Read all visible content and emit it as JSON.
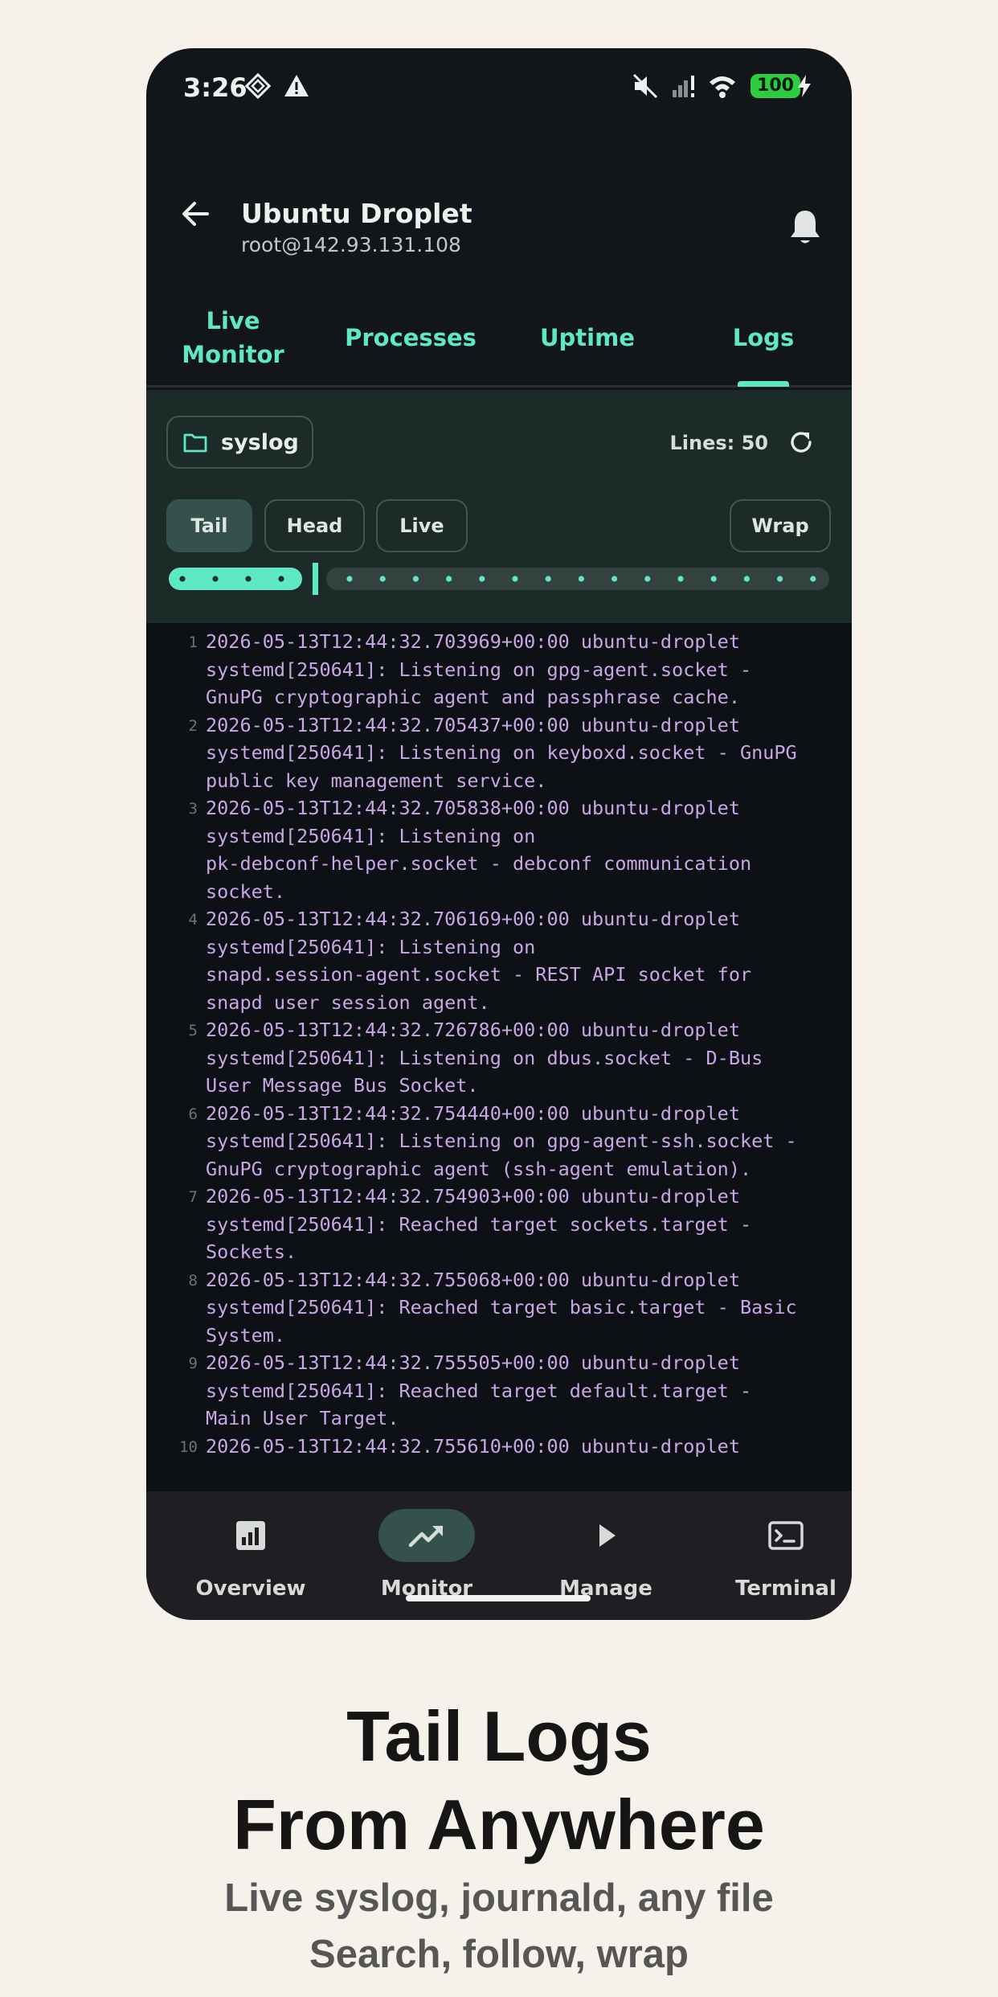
{
  "status_bar": {
    "time": "3:26",
    "battery": "100",
    "icons": [
      "vpn-key-icon",
      "alert-icon",
      "mute-icon",
      "signal-icon",
      "wifi-icon",
      "battery-charging-icon"
    ]
  },
  "app_bar": {
    "title": "Ubuntu Droplet",
    "subtitle": "root@142.93.131.108"
  },
  "tabs": [
    {
      "label": "Live\nMonitor"
    },
    {
      "label": "Processes"
    },
    {
      "label": "Uptime"
    },
    {
      "label": "Logs",
      "selected": true
    }
  ],
  "controls": {
    "file": "syslog",
    "lines_label": "Lines: 50",
    "modes": [
      {
        "label": "Tail",
        "selected": true
      },
      {
        "label": "Head"
      },
      {
        "label": "Live"
      }
    ],
    "wrap_label": "Wrap",
    "slider_value": 0.22
  },
  "log_lines": [
    {
      "n": "1",
      "text": "2026-05-13T12:44:32.703969+00:00 ubuntu-droplet\nsystemd[250641]: Listening on gpg-agent.socket -\nGnuPG cryptographic agent and passphrase cache."
    },
    {
      "n": "2",
      "text": "2026-05-13T12:44:32.705437+00:00 ubuntu-droplet\nsystemd[250641]: Listening on keyboxd.socket - GnuPG\npublic key management service."
    },
    {
      "n": "3",
      "text": "2026-05-13T12:44:32.705838+00:00 ubuntu-droplet\nsystemd[250641]: Listening on\npk-debconf-helper.socket - debconf communication\nsocket."
    },
    {
      "n": "4",
      "text": "2026-05-13T12:44:32.706169+00:00 ubuntu-droplet\nsystemd[250641]: Listening on\nsnapd.session-agent.socket - REST API socket for\nsnapd user session agent."
    },
    {
      "n": "5",
      "text": "2026-05-13T12:44:32.726786+00:00 ubuntu-droplet\nsystemd[250641]: Listening on dbus.socket - D-Bus\nUser Message Bus Socket."
    },
    {
      "n": "6",
      "text": "2026-05-13T12:44:32.754440+00:00 ubuntu-droplet\nsystemd[250641]: Listening on gpg-agent-ssh.socket -\nGnuPG cryptographic agent (ssh-agent emulation)."
    },
    {
      "n": "7",
      "text": "2026-05-13T12:44:32.754903+00:00 ubuntu-droplet\nsystemd[250641]: Reached target sockets.target -\nSockets."
    },
    {
      "n": "8",
      "text": "2026-05-13T12:44:32.755068+00:00 ubuntu-droplet\nsystemd[250641]: Reached target basic.target - Basic\nSystem."
    },
    {
      "n": "9",
      "text": "2026-05-13T12:44:32.755505+00:00 ubuntu-droplet\nsystemd[250641]: Reached target default.target -\nMain User Target."
    },
    {
      "n": "10",
      "text": "2026-05-13T12:44:32.755610+00:00 ubuntu-droplet"
    }
  ],
  "bottom_nav": [
    {
      "label": "Overview",
      "icon": "bar-chart-icon"
    },
    {
      "label": "Monitor",
      "icon": "trending-up-icon",
      "active": true
    },
    {
      "label": "Manage",
      "icon": "play-icon"
    },
    {
      "label": "Terminal",
      "icon": "terminal-icon"
    }
  ],
  "caption": {
    "headline": "Tail Logs\nFrom Anywhere",
    "subline": "Live syslog, journald, any file\nSearch, follow, wrap"
  },
  "colors": {
    "accent": "#5ee8c4",
    "log_text": "#c9a7e6",
    "background": "#f6f1ea",
    "app_bg": "#12161a"
  }
}
